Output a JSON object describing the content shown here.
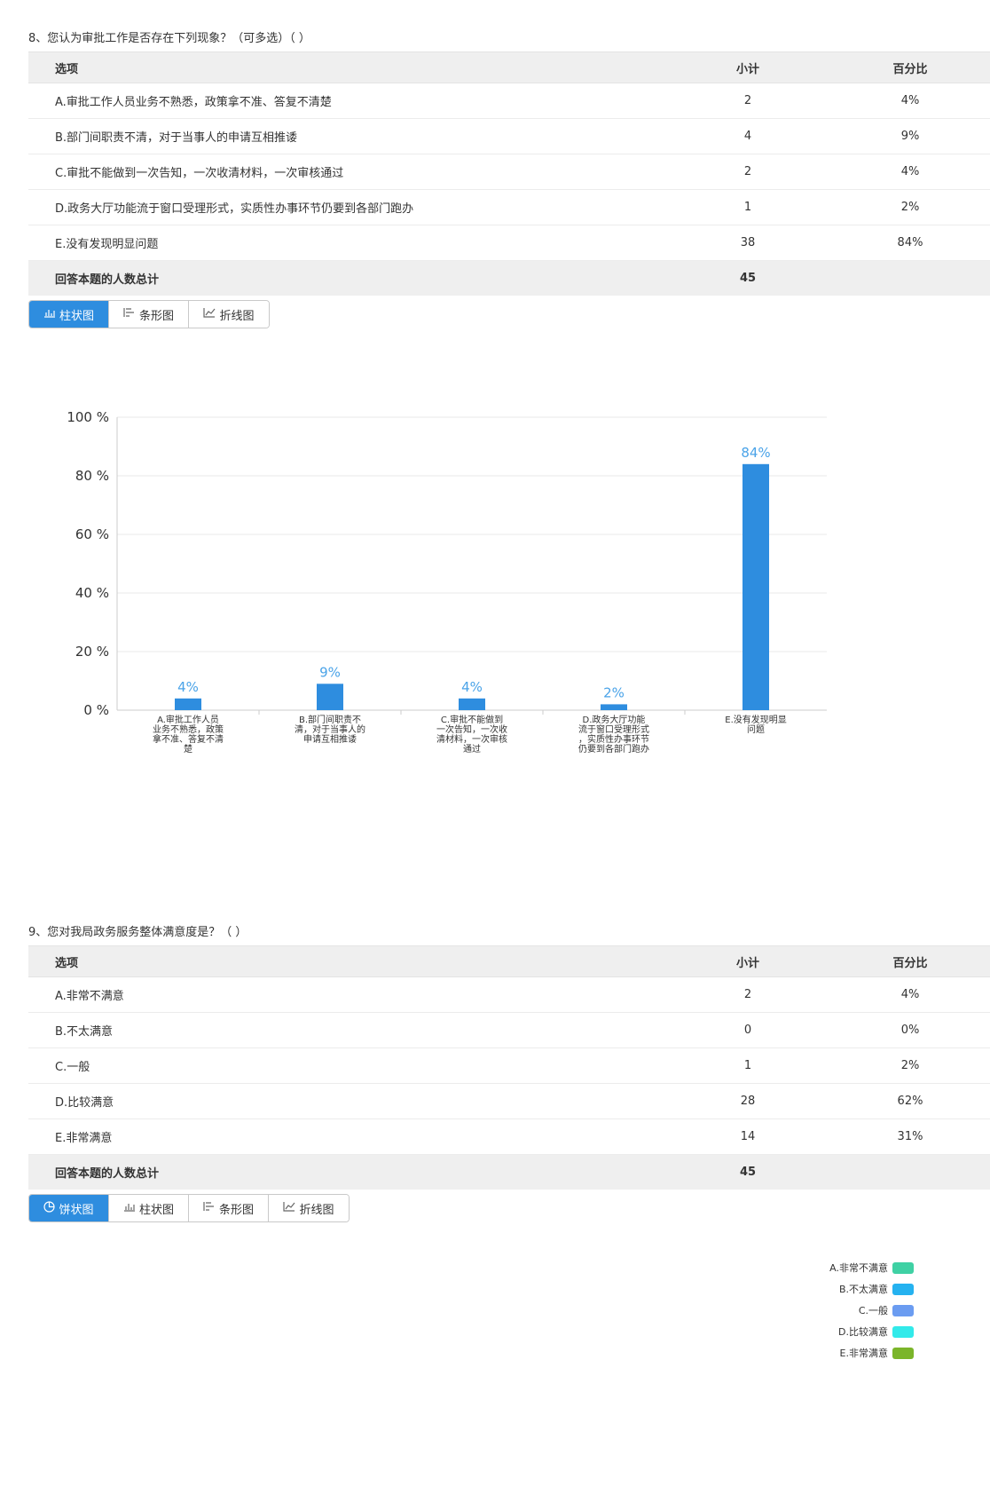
{
  "q8": {
    "title": "8、您认为审批工作是否存在下列现象？（可多选）（ ）",
    "headers": {
      "option": "选项",
      "count": "小计",
      "percent": "百分比"
    },
    "rows": [
      {
        "option": "A.审批工作人员业务不熟悉，政策拿不准、答复不清楚",
        "count": "2",
        "percent": "4%"
      },
      {
        "option": "B.部门间职责不清，对于当事人的申请互相推诿",
        "count": "4",
        "percent": "9%"
      },
      {
        "option": "C.审批不能做到一次告知，一次收清材料，一次审核通过",
        "count": "2",
        "percent": "4%"
      },
      {
        "option": "D.政务大厅功能流于窗口受理形式，实质性办事环节仍要到各部门跑办",
        "count": "1",
        "percent": "2%"
      },
      {
        "option": "E.没有发现明显问题",
        "count": "38",
        "percent": "84%"
      }
    ],
    "total_label": "回答本题的人数总计",
    "total": "45",
    "tabs": [
      {
        "label": "柱状图",
        "icon": "bar-chart-icon",
        "active": true
      },
      {
        "label": "条形图",
        "icon": "horizontal-bar-icon",
        "active": false
      },
      {
        "label": "折线图",
        "icon": "line-chart-icon",
        "active": false
      }
    ]
  },
  "chart_data": {
    "type": "bar",
    "categories": [
      "A.审批工作人员业务不熟悉，政策拿不准、答复不清楚",
      "B.部门间职责不清，对于当事人的申请互相推诿",
      "C.审批不能做到一次告知，一次收清材料，一次审核通过",
      "D.政务大厅功能流于窗口受理形式，实质性办事环节仍要到各部门跑办",
      "E.没有发现明显问题"
    ],
    "category_lines": [
      [
        "A.审批工作人员",
        "业务不熟悉，政策",
        "拿不准、答复不清",
        "楚"
      ],
      [
        "B.部门间职责不",
        "清，对于当事人的",
        "申请互相推诿"
      ],
      [
        "C.审批不能做到",
        "一次告知，一次收",
        "清材料，一次审核",
        "通过"
      ],
      [
        "D.政务大厅功能",
        "流于窗口受理形式",
        "，实质性办事环节",
        "仍要到各部门跑办"
      ],
      [
        "E.没有发现明显",
        "问题"
      ]
    ],
    "values": [
      4,
      9,
      4,
      2,
      84
    ],
    "data_labels": [
      "4%",
      "9%",
      "4%",
      "2%",
      "84%"
    ],
    "y_ticks": [
      "0 %",
      "20 %",
      "40 %",
      "60 %",
      "80 %",
      "100 %"
    ],
    "ylim": [
      0,
      100
    ],
    "grid": true,
    "bar_color": "#2e8ddf",
    "label_color": "#4aa3e8"
  },
  "q9": {
    "title": "9、您对我局政务服务整体满意度是？（ ）",
    "headers": {
      "option": "选项",
      "count": "小计",
      "percent": "百分比"
    },
    "rows": [
      {
        "option": "A.非常不满意",
        "count": "2",
        "percent": "4%"
      },
      {
        "option": "B.不太满意",
        "count": "0",
        "percent": "0%"
      },
      {
        "option": "C.一般",
        "count": "1",
        "percent": "2%"
      },
      {
        "option": "D.比较满意",
        "count": "28",
        "percent": "62%"
      },
      {
        "option": "E.非常满意",
        "count": "14",
        "percent": "31%"
      }
    ],
    "total_label": "回答本题的人数总计",
    "total": "45",
    "tabs": [
      {
        "label": "饼状图",
        "icon": "pie-chart-icon",
        "active": true
      },
      {
        "label": "柱状图",
        "icon": "bar-chart-icon",
        "active": false
      },
      {
        "label": "条形图",
        "icon": "horizontal-bar-icon",
        "active": false
      },
      {
        "label": "折线图",
        "icon": "line-chart-icon",
        "active": false
      }
    ],
    "legend": [
      {
        "label": "A.非常不满意",
        "color": "#3fd1a4"
      },
      {
        "label": "B.不太满意",
        "color": "#25b2f0"
      },
      {
        "label": "C.一般",
        "color": "#6b9cf1"
      },
      {
        "label": "D.比较满意",
        "color": "#32eaea"
      },
      {
        "label": "E.非常满意",
        "color": "#7bb52a"
      }
    ]
  }
}
